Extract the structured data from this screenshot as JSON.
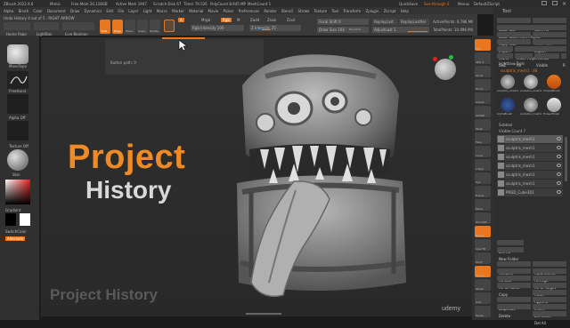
{
  "titlebar": {
    "app": "ZBrush 2022.0.6",
    "file": "Mimic",
    "free_mem": "Free Mem 20.118GB",
    "active_mem": "Active Mem 1947",
    "scratch": "Scratch Disk 67",
    "timer": "Timer 79.526",
    "polycount": "PolyCount 8.945 MP",
    "meshcount": "MeshCount 1",
    "quicksave": "QuickSave",
    "seethrough": "See-through 0",
    "menus": "Menus",
    "default_script": "DefaultZScript"
  },
  "menubar": {
    "items": [
      "Alpha",
      "Brush",
      "Color",
      "Document",
      "Draw",
      "Dynamics",
      "Edit",
      "File",
      "Layer",
      "Light",
      "Macro",
      "Marker",
      "Material",
      "Movie",
      "Picker",
      "Preferences",
      "Render",
      "Stencil",
      "Stroke",
      "Texture",
      "Tool",
      "Transform",
      "Zplugin",
      "Zscript",
      "Help"
    ]
  },
  "undo_label": "Undo History 4 out of 5 : RIGHT ARROW",
  "toolbar": {
    "home_page": "Home Page",
    "lightbox": "LightBox",
    "live_boolean": "Live Boolean",
    "edit": "Edit",
    "draw": "Draw",
    "move": "Move",
    "scale": "Scale",
    "rotate": "Rotate",
    "a_label": "A",
    "mrgb": "Mrgb",
    "rgb": "Rgb",
    "m": "M",
    "zadd": "Zadd",
    "zsub": "Zsub",
    "zcut": "Zcut",
    "rgb_intensity": "Rgb Intensity 100",
    "z_intensity": "Z Intensity 25",
    "focal_shift": "Focal Shift 0",
    "draw_size": "Draw Size 104",
    "dynamic": "Dynamic",
    "replay_last": "ReplayLast",
    "replay_last_rel": "ReplayLastRel",
    "adjust_last": "AdjustLast 1",
    "active_points": "ActivePoints: 8.786 Mil",
    "total_points": "TotalPoints: 10.496 Mil"
  },
  "tooltip": {
    "text": "Button path: 0"
  },
  "leftshelf": {
    "brush": "MoveTopo",
    "stroke": "FreeHand",
    "alpha": "Alpha Off",
    "texture": "Texture Off",
    "material": "Skin",
    "gradient": "Gradient",
    "switch_color": "SwitchColor",
    "alternate": "Alternate"
  },
  "viewport": {
    "heading": "Project",
    "subheading": "History",
    "bottom_label": "Project History",
    "watermark": "udemy"
  },
  "rightshelf": {
    "items": [
      "BPR",
      "SPix 3",
      "Scroll",
      "Zoom",
      "Actual",
      "AAHalf",
      "Persp",
      "Floor",
      "Local",
      "L.Sym",
      "Xyz",
      "Frame",
      "Move",
      "Zoom3D",
      "Rotate",
      "Line Fill",
      "PolyF",
      "Transp",
      "Ghost",
      "Solo",
      "Xpose"
    ]
  },
  "tool_panel": {
    "title": "Tool",
    "load_tool": "Load Tool",
    "save_as": "Save As",
    "load_tools_from_project": "Load Tools From Project",
    "copy_tool": "Copy Tool",
    "paste_tool": "Paste Tool",
    "import": "Import",
    "export": "Export",
    "clone": "Clone",
    "make_polymesh": "Make PolyMesh3D",
    "goz": "GoZ",
    "all": "All",
    "visible": "Visible",
    "r": "R",
    "lightbox_tools": "Lightbox▸Tools",
    "current_tool": "sculptris_mesh1 : 48",
    "thumbs": [
      "sculptris_mesh1",
      "sculptris_mesh1",
      "SimpleBrush",
      "AlphaBrush",
      "sculptris_mesh1",
      "EraserBrush"
    ],
    "subtool": "Subtool",
    "visible_count": "Visible Count 7",
    "subtools": [
      "sculptris_mesh1",
      "sculptris_mesh1",
      "sculptris_mesh1",
      "sculptris_mesh1",
      "sculptris_mesh1",
      "sculptris_mesh1",
      "PM3D_Cube3D1"
    ],
    "list_all": "List All",
    "new_folder": "New Folder",
    "rename": "Rename",
    "autoreorder": "AutoReorder",
    "all_low": "All Low",
    "all_high": "All High",
    "all_to_home": "All To Home",
    "all_to_target": "All To Target",
    "copy": "Copy",
    "paste": "Paste",
    "append": "Append",
    "duplicate": "Duplicate",
    "insert": "Insert",
    "delete": "Delete",
    "del_other": "Del Other",
    "del_all": "Del All"
  },
  "colors": {
    "accent": "#e8771f",
    "heading": "#f08a24",
    "subheading": "#d8d8d8",
    "panel": "#2e2e2e",
    "viewport": "#2c2c2c"
  }
}
